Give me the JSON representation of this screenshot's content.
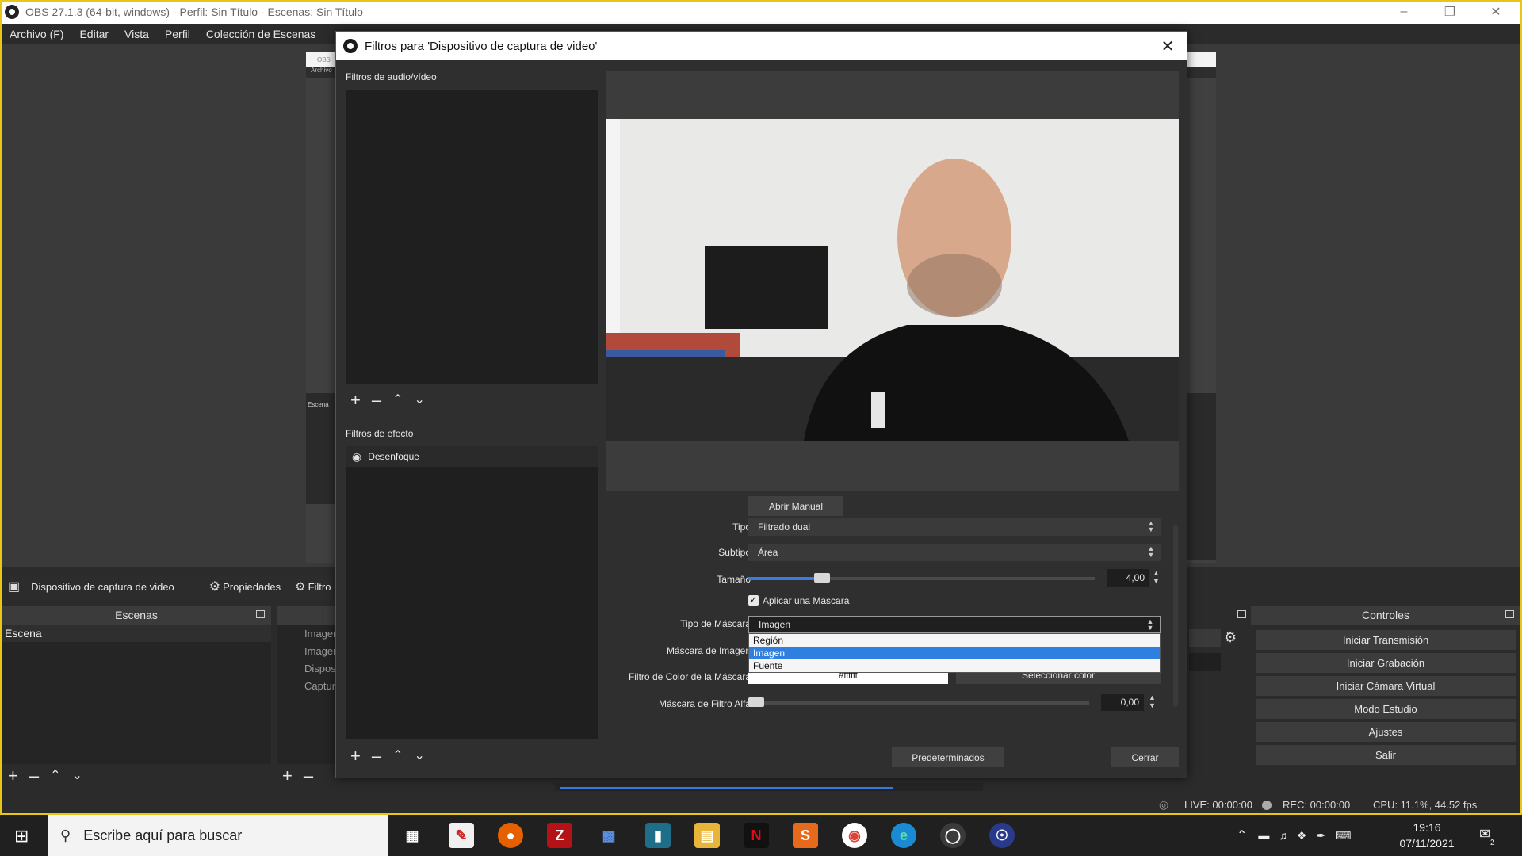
{
  "window": {
    "title": "OBS 27.1.3 (64-bit, windows) - Perfil: Sin Título - Escenas: Sin Título"
  },
  "menu": [
    "Archivo (F)",
    "Editar",
    "Vista",
    "Perfil",
    "Colección de Escenas"
  ],
  "behind": {
    "mini_header": "OBS",
    "mini_menu": "Archivo",
    "mini_scene_label": "Escena"
  },
  "source_bar": {
    "source_name": "Dispositivo de captura de video",
    "properties_label": "Propiedades",
    "filters_label": "Filtro"
  },
  "scenes_dock": {
    "title": "Escenas",
    "items": [
      "Escena"
    ]
  },
  "sources_dock": {
    "items": [
      "Imagen",
      "Imagen",
      "Disposi",
      "Captur"
    ]
  },
  "controls_dock": {
    "title": "Controles",
    "buttons": [
      "Iniciar Transmisión",
      "Iniciar Grabación",
      "Iniciar Cámara Virtual",
      "Modo Estudio",
      "Ajustes",
      "Salir"
    ]
  },
  "status": {
    "live": "LIVE: 00:00:00",
    "rec": "REC: 00:00:00",
    "cpu": "CPU: 11.1%, 44.52 fps"
  },
  "dialog": {
    "title": "Filtros para 'Dispositivo de captura de video'",
    "av_filters_label": "Filtros de audio/vídeo",
    "effect_filters_label": "Filtros de efecto",
    "effect_filters": [
      "Desenfoque"
    ],
    "open_manual": "Abrir Manual",
    "props": {
      "tipo_label": "Tipo",
      "tipo_value": "Filtrado dual",
      "subtipo_label": "Subtipo",
      "subtipo_value": "Área",
      "tamano_label": "Tamaño",
      "tamano_value": "4,00",
      "tamano_fraction": 0.2,
      "aplicar_mascara_label": "Aplicar una Máscara",
      "aplicar_mascara_checked": true,
      "tipo_mascara_label": "Tipo de Máscara",
      "tipo_mascara_value": "Imagen",
      "tipo_mascara_options": [
        "Región",
        "Imagen",
        "Fuente"
      ],
      "tipo_mascara_selected_index": 1,
      "mascara_imagen_label": "Máscara de Imagen",
      "filtro_color_label": "Filtro de Color de la Máscara",
      "filtro_color_value": "#ffffff",
      "select_color_label": "Seleccionar color",
      "alfa_label": "Máscara de Filtro Alfa",
      "alfa_value": "0,00",
      "alfa_fraction": 0.0
    },
    "defaults_button": "Predeterminados",
    "close_button": "Cerrar"
  },
  "taskbar": {
    "search_placeholder": "Escribe aquí para buscar",
    "time": "19:16",
    "date": "07/11/2021",
    "notification_count": "2"
  }
}
